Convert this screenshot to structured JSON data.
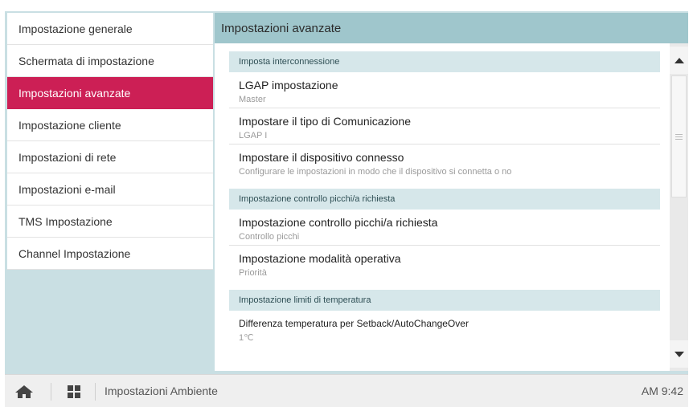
{
  "menu": {
    "items": [
      {
        "label": "Impostazione generale",
        "active": false
      },
      {
        "label": "Schermata di impostazione",
        "active": false
      },
      {
        "label": "Impostazioni avanzate",
        "active": true
      },
      {
        "label": "Impostazione cliente",
        "active": false
      },
      {
        "label": "Impostazioni di rete",
        "active": false
      },
      {
        "label": "Impostazioni e-mail",
        "active": false
      },
      {
        "label": "TMS Impostazione",
        "active": false
      },
      {
        "label": "Channel Impostazione",
        "active": false
      }
    ]
  },
  "panel": {
    "title": "Impostazioni avanzate",
    "sections": [
      {
        "header": "Imposta interconnessione",
        "rows": [
          {
            "title": "LGAP impostazione",
            "value": "Master"
          },
          {
            "title": "Impostare il tipo di Comunicazione",
            "value": "LGAP I"
          },
          {
            "title": "Impostare il dispositivo connesso",
            "value": "Configurare le impostazioni in modo che il dispositivo si connetta o no"
          }
        ]
      },
      {
        "header": "Impostazione controllo picchi/a richiesta",
        "rows": [
          {
            "title": "Impostazione controllo picchi/a richiesta",
            "value": "Controllo picchi"
          },
          {
            "title": "Impostazione modalità operativa",
            "value": "Priorità"
          }
        ]
      },
      {
        "header": "Impostazione limiti di temperatura",
        "rows": [
          {
            "title": "Differenza temperatura per Setback/AutoChangeOver",
            "value": "1℃"
          }
        ]
      }
    ]
  },
  "scrollbar": {
    "up_icon": "triangle-up-icon",
    "down_icon": "triangle-down-icon",
    "position": 0.0
  },
  "bottombar": {
    "home_icon": "home-icon",
    "apps_icon": "grid-icon",
    "label": "Impostazioni Ambiente",
    "time": "AM 9:42"
  },
  "colors": {
    "accent": "#cc1f55",
    "frame_bg": "#c9dfe3",
    "title_bar": "#9fc6cc",
    "section_bg": "#d6e7ea"
  }
}
